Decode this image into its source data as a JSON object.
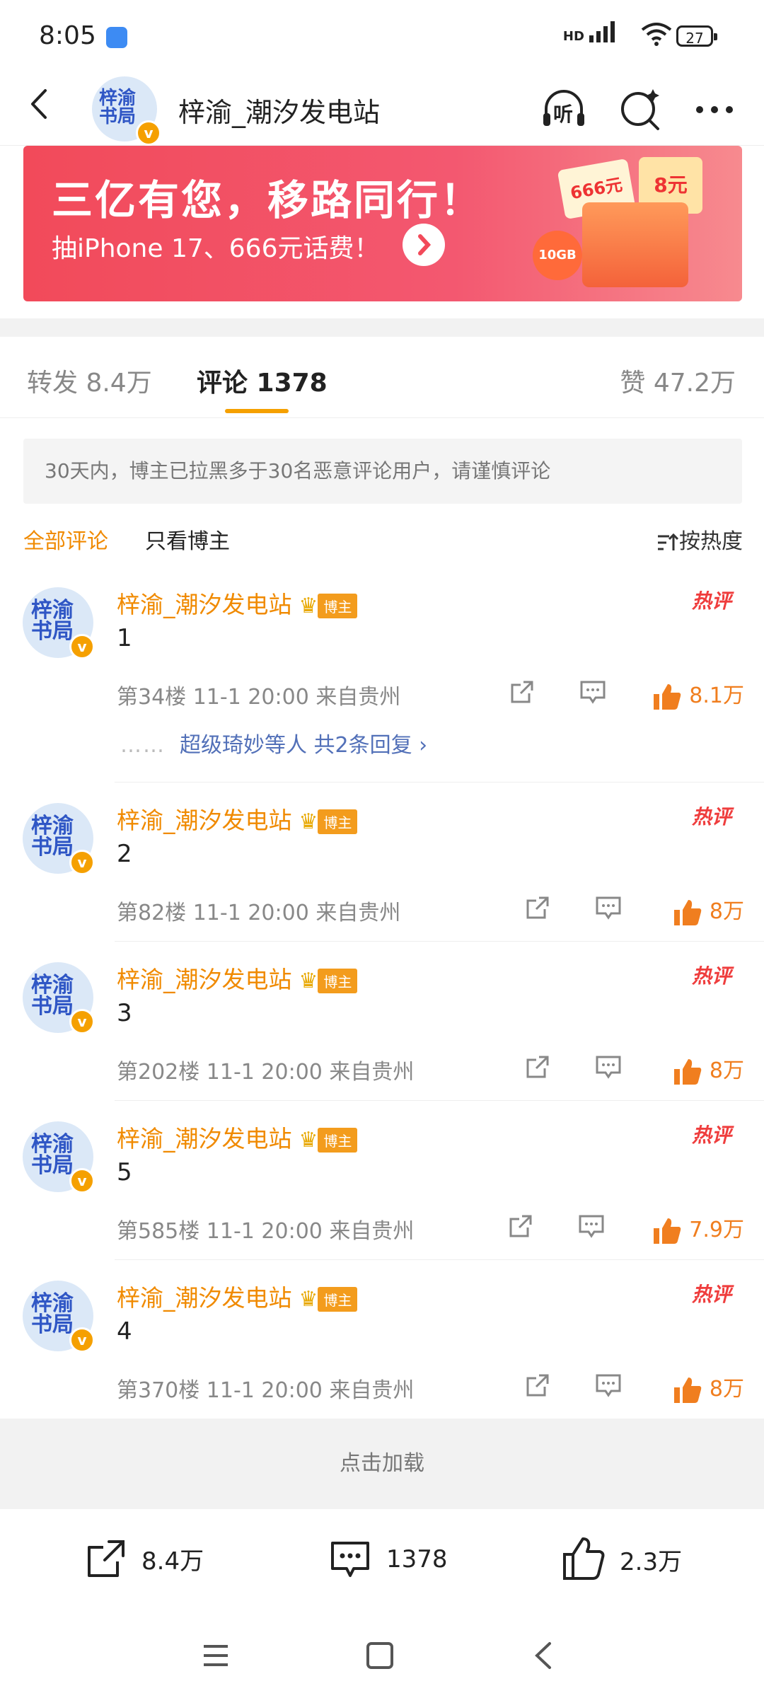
{
  "status": {
    "time": "8:05",
    "signal": "HD",
    "battery": "27"
  },
  "header": {
    "avatar_text": "梓渝书局",
    "title": "梓渝_潮汐发电站",
    "listen_label": "听"
  },
  "banner": {
    "headline": "三亿有您，移路同行！",
    "subline": "抽iPhone 17、666元话费！",
    "art_label1": "666元",
    "art_label2": "8元",
    "art_label3": "10GB"
  },
  "tabs": [
    {
      "label": "转发 8.4万"
    },
    {
      "label": "评论 1378"
    },
    {
      "label": "赞 47.2万"
    }
  ],
  "notice": "30天内，博主已拉黑多于30名恶意评论用户，请谨慎评论",
  "filters": {
    "all": "全部评论",
    "owner": "只看博主",
    "sort": "按热度"
  },
  "comments": [
    {
      "name": "梓渝_潮汐发电站",
      "tag": "博主",
      "hot": "热评",
      "text": "1",
      "meta": "第34楼  11-1 20:00  来自贵州",
      "likes": "8.1万",
      "replies": "超级琦妙等人  共2条回复 ›"
    },
    {
      "name": "梓渝_潮汐发电站",
      "tag": "博主",
      "hot": "热评",
      "text": "2",
      "meta": "第82楼  11-1 20:00  来自贵州",
      "likes": "8万"
    },
    {
      "name": "梓渝_潮汐发电站",
      "tag": "博主",
      "hot": "热评",
      "text": "3",
      "meta": "第202楼  11-1 20:00  来自贵州",
      "likes": "8万"
    },
    {
      "name": "梓渝_潮汐发电站",
      "tag": "博主",
      "hot": "热评",
      "text": "5",
      "meta": "第585楼  11-1 20:00  来自贵州",
      "likes": "7.9万"
    },
    {
      "name": "梓渝_潮汐发电站",
      "tag": "博主",
      "hot": "热评",
      "text": "4",
      "meta": "第370楼  11-1 20:00  来自贵州",
      "likes": "8万"
    }
  ],
  "loadmore": "点击加载",
  "bottombar": {
    "share": "8.4万",
    "comment": "1378",
    "like": "2.3万"
  }
}
